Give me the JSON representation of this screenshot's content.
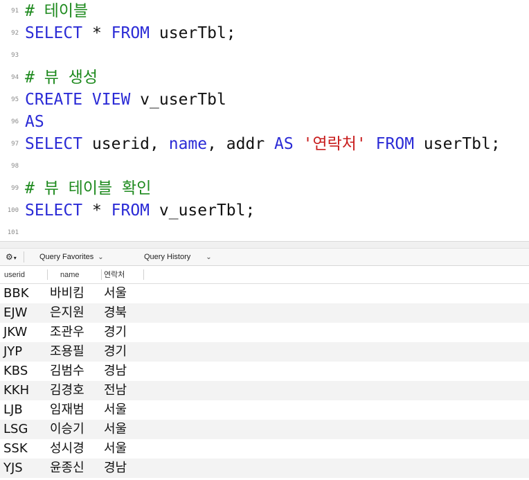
{
  "editor": {
    "lines": [
      {
        "num": "91",
        "tokens": [
          {
            "t": "cm",
            "v": "# 테이블"
          }
        ]
      },
      {
        "num": "92",
        "tokens": [
          {
            "t": "kw",
            "v": "SELECT"
          },
          {
            "t": "tx",
            "v": " * "
          },
          {
            "t": "kw",
            "v": "FROM"
          },
          {
            "t": "tx",
            "v": " userTbl;"
          }
        ]
      },
      {
        "num": "93",
        "tokens": []
      },
      {
        "num": "94",
        "tokens": [
          {
            "t": "cm",
            "v": "# 뷰 생성"
          }
        ]
      },
      {
        "num": "95",
        "tokens": [
          {
            "t": "kw",
            "v": "CREATE VIEW"
          },
          {
            "t": "tx",
            "v": " v_userTbl"
          }
        ]
      },
      {
        "num": "96",
        "tokens": [
          {
            "t": "kw",
            "v": "AS"
          }
        ]
      },
      {
        "num": "97",
        "tokens": [
          {
            "t": "kw",
            "v": "SELECT"
          },
          {
            "t": "tx",
            "v": " userid, "
          },
          {
            "t": "kw",
            "v": "name"
          },
          {
            "t": "tx",
            "v": ", addr "
          },
          {
            "t": "kw",
            "v": "AS"
          },
          {
            "t": "tx",
            "v": " "
          },
          {
            "t": "str",
            "v": "'연락처'"
          },
          {
            "t": "tx",
            "v": " "
          },
          {
            "t": "kw",
            "v": "FROM"
          },
          {
            "t": "tx",
            "v": " userTbl;"
          }
        ]
      },
      {
        "num": "98",
        "tokens": []
      },
      {
        "num": "99",
        "tokens": [
          {
            "t": "cm",
            "v": "# 뷰 테이블 확인"
          }
        ]
      },
      {
        "num": "100",
        "tokens": [
          {
            "t": "kw",
            "v": "SELECT"
          },
          {
            "t": "tx",
            "v": " * "
          },
          {
            "t": "kw",
            "v": "FROM"
          },
          {
            "t": "tx",
            "v": " v_userTbl;"
          }
        ]
      },
      {
        "num": "101",
        "tokens": []
      }
    ]
  },
  "toolbar": {
    "gear_icon": "gear-icon",
    "query_favorites_label": "Query Favorites",
    "query_history_label": "Query History"
  },
  "results": {
    "columns": [
      "userid",
      "name",
      "연락처"
    ],
    "rows": [
      [
        "BBK",
        "바비킴",
        "서울"
      ],
      [
        "EJW",
        "은지원",
        "경북"
      ],
      [
        "JKW",
        "조관우",
        "경기"
      ],
      [
        "JYP",
        "조용필",
        "경기"
      ],
      [
        "KBS",
        "김범수",
        "경남"
      ],
      [
        "KKH",
        "김경호",
        "전남"
      ],
      [
        "LJB",
        "임재범",
        "서울"
      ],
      [
        "LSG",
        "이승기",
        "서울"
      ],
      [
        "SSK",
        "성시경",
        "서울"
      ],
      [
        "YJS",
        "윤종신",
        "경남"
      ]
    ]
  }
}
